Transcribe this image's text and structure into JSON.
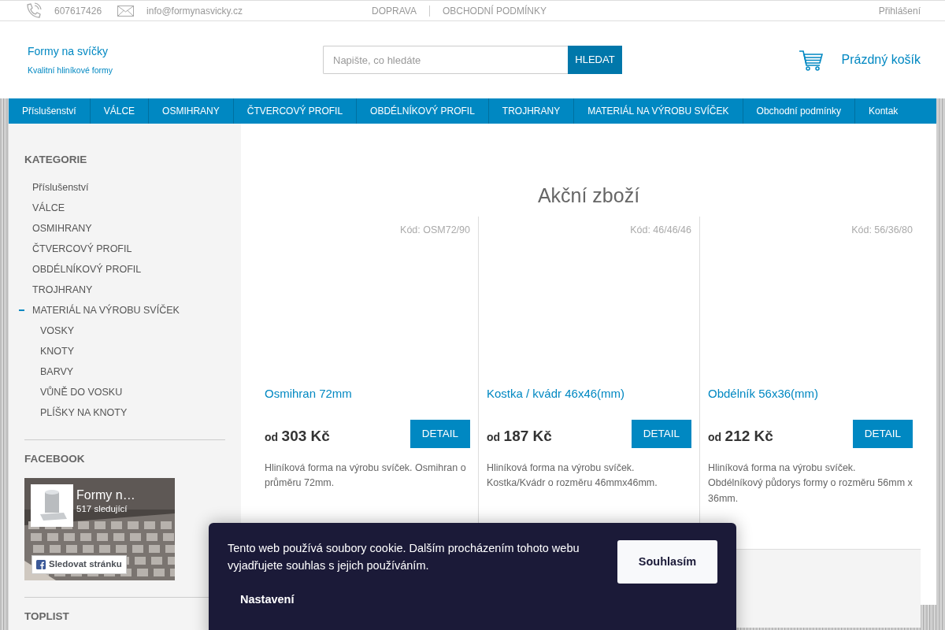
{
  "top_bar": {
    "phone": "607617426",
    "email": "info@formynasvicky.cz",
    "links": [
      "DOPRAVA",
      "OBCHODNÍ PODMÍNKY"
    ],
    "login": "Přihlášení"
  },
  "header": {
    "logo_title": "Formy na svíčky",
    "logo_subtitle": "Kvalitní hliníkové formy",
    "search": {
      "placeholder": "Napište, co hledáte",
      "button": "HLEDAT"
    },
    "cart": "Prázdný košík"
  },
  "menu": [
    "Příslušenství",
    "VÁLCE",
    "OSMIHRANY",
    "ČTVERCOVÝ PROFIL",
    "OBDÉLNÍKOVÝ PROFIL",
    "TROJHRANY",
    "MATERIÁL NA VÝROBU SVÍČEK",
    "Obchodní podmínky",
    "Kontak"
  ],
  "sidebar": {
    "categories_title": "KATEGORIE",
    "categories": [
      {
        "label": "Příslušenství",
        "expanded": false
      },
      {
        "label": "VÁLCE",
        "expanded": false
      },
      {
        "label": "OSMIHRANY",
        "expanded": false
      },
      {
        "label": "ČTVERCOVÝ PROFIL",
        "expanded": false
      },
      {
        "label": "OBDÉLNÍKOVÝ PROFIL",
        "expanded": false
      },
      {
        "label": "TROJHRANY",
        "expanded": false
      },
      {
        "label": "MATERIÁL NA VÝROBU SVÍČEK",
        "expanded": true,
        "children": [
          {
            "label": "VOSKY"
          },
          {
            "label": "KNOTY"
          },
          {
            "label": "BARVY"
          },
          {
            "label": "VŮNĚ DO VOSKU"
          },
          {
            "label": "PLÍŠKY NA KNOTY"
          }
        ]
      }
    ],
    "facebook_title": "FACEBOOK",
    "facebook": {
      "page_name": "Formy n…",
      "followers": "517 sledující",
      "follow_button": "Sledovat stránku"
    },
    "toplist_title": "TOPLIST"
  },
  "content": {
    "title": "Akční zboží",
    "products": [
      {
        "code": "Kód: OSM72/90",
        "name": "Osmihran 72mm",
        "price_prefix": "od",
        "price": "303 Kč",
        "button": "DETAIL",
        "description": "Hliníková forma na výrobu svíček. Osmihran o průměru 72mm."
      },
      {
        "code": "Kód: 46/46/46",
        "name": "Kostka / kvádr 46x46(mm)",
        "price_prefix": "od",
        "price": "187 Kč",
        "button": "DETAIL",
        "description": "Hliníková forma na výrobu svíček. Kostka/Kvádr o rozměru 46mmx46mm."
      },
      {
        "code": "Kód: 56/36/80",
        "name": "Obdélník 56x36(mm)",
        "price_prefix": "od",
        "price": "212 Kč",
        "button": "DETAIL",
        "description": "Hliníková forma na výrobu svíček. Obdélníkový půdorys formy o rozměru 56mm x 36mm."
      }
    ]
  },
  "cookie_bar": {
    "text": "Tento web používá soubory cookie. Dalším procházením tohoto webu vyjadřujete souhlas s jejich používáním.",
    "accept": "Souhlasím",
    "settings": "Nastavení"
  }
}
